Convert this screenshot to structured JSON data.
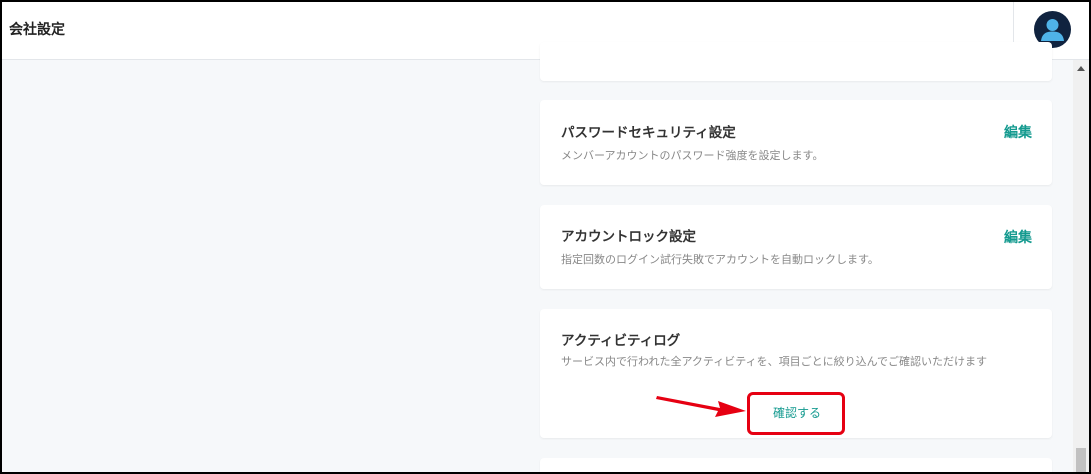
{
  "header": {
    "title": "会社設定",
    "avatar_icon": "user-avatar-icon"
  },
  "cards": [
    {
      "title": "パスワードセキュリティ設定",
      "description": "メンバーアカウントのパスワード強度を設定します。",
      "action_label": "編集"
    },
    {
      "title": "アカウントロック設定",
      "description": "指定回数のログイン試行失敗でアカウントを自動ロックします。",
      "action_label": "編集"
    },
    {
      "title": "アクティビティログ",
      "description": "サービス内で行われた全アクティビティを、項目ごとに絞り込んでご確認いただけます",
      "action_label": "確認する"
    }
  ],
  "colors": {
    "accent": "#149a8f",
    "highlight": "#e60012",
    "avatar_bg": "#10233f"
  }
}
